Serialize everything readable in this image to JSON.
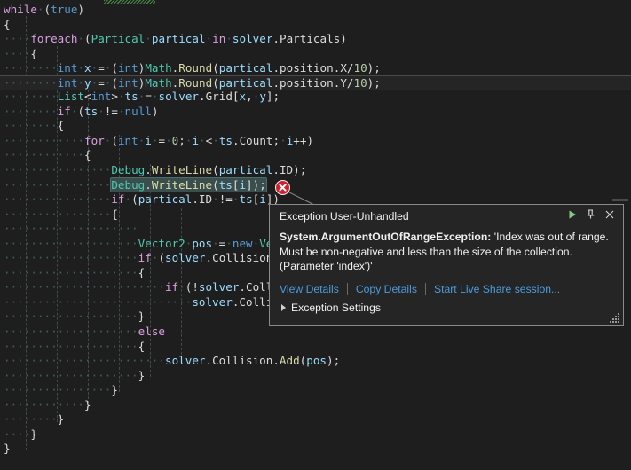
{
  "app": {
    "theme": "visual-studio-dark",
    "editor_background": "#1e1e1e",
    "current_line_background": "#252526",
    "highlight_statement_background": "#3a4f4d"
  },
  "code": {
    "language": "csharp",
    "lines": [
      {
        "indent": 0,
        "text": "while (true)"
      },
      {
        "indent": 0,
        "text": "{"
      },
      {
        "indent": 1,
        "text": "foreach (Partical partical in solver.Particals)"
      },
      {
        "indent": 1,
        "text": "{"
      },
      {
        "indent": 2,
        "text": "int x = (int)Math.Round(partical.position.X/10);"
      },
      {
        "indent": 2,
        "text": "int y = (int)Math.Round(partical.position.Y/10);"
      },
      {
        "indent": 2,
        "text": "List<int> ts = solver.Grid[x, y];"
      },
      {
        "indent": 2,
        "text": "if (ts != null)"
      },
      {
        "indent": 2,
        "text": "{"
      },
      {
        "indent": 3,
        "text": "for (int i = 0; i < ts.Count; i++)"
      },
      {
        "indent": 3,
        "text": "{"
      },
      {
        "indent": 4,
        "text": "Debug.WriteLine(partical.ID);"
      },
      {
        "indent": 4,
        "text": "Debug.WriteLine(ts[i]);"
      },
      {
        "indent": 4,
        "text": "if (partical.ID != ts[i])"
      },
      {
        "indent": 4,
        "text": "{"
      },
      {
        "indent": 5,
        "text": ""
      },
      {
        "indent": 5,
        "text": "Vector2 pos = new Ve"
      },
      {
        "indent": 5,
        "text": "if (solver.Collision"
      },
      {
        "indent": 5,
        "text": "{"
      },
      {
        "indent": 6,
        "text": "if (!solver.Coll"
      },
      {
        "indent": 7,
        "text": "solver.Colli"
      },
      {
        "indent": 5,
        "text": "}"
      },
      {
        "indent": 5,
        "text": "else"
      },
      {
        "indent": 5,
        "text": "{"
      },
      {
        "indent": 6,
        "text": "solver.Collision.Add(pos);"
      },
      {
        "indent": 5,
        "text": "}"
      },
      {
        "indent": 4,
        "text": "}"
      },
      {
        "indent": 3,
        "text": "}"
      },
      {
        "indent": 2,
        "text": "}"
      },
      {
        "indent": 1,
        "text": "}"
      },
      {
        "indent": 0,
        "text": "}"
      }
    ],
    "current_line_index": 5,
    "exception_line_index": 12,
    "exception_statement": "Debug.WriteLine(ts[i]);"
  },
  "exception_popup": {
    "title": "Exception User-Unhandled",
    "exception_type": "System.ArgumentOutOfRangeException:",
    "message": " 'Index was out of range. Must be non-negative and less than the size of the collection. (Parameter 'index')'",
    "links": [
      {
        "label": "View Details",
        "name": "view-details-link"
      },
      {
        "label": "Copy Details",
        "name": "copy-details-link"
      },
      {
        "label": "Start Live Share session...",
        "name": "start-live-share-link"
      }
    ],
    "settings_label": "Exception Settings",
    "header_buttons": [
      {
        "name": "continue-button",
        "icon": "play-icon"
      },
      {
        "name": "pin-button",
        "icon": "pin-icon"
      },
      {
        "name": "close-button",
        "icon": "close-icon"
      }
    ],
    "link_color": "#4a9cdc",
    "accent_play_color": "#84c984",
    "error_marker_color": "#d32030"
  }
}
